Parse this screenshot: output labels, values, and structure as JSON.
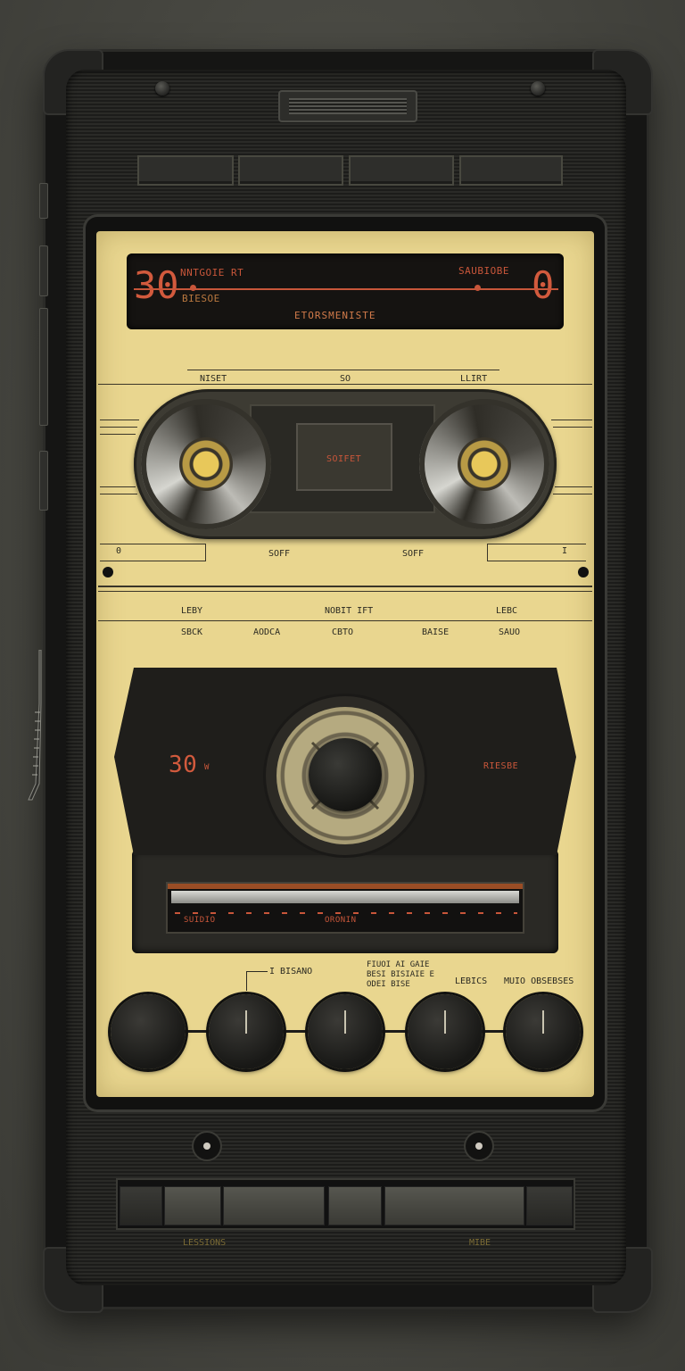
{
  "display": {
    "counter_left": "30",
    "left_line1": "NNTGOIE RT",
    "left_line2": "BIESOE",
    "right_line1": "SAUBIOBE",
    "counter_right": "0",
    "center_label": "ETORSMENISTE"
  },
  "tape": {
    "top_left": "NISET",
    "top_center": "SO",
    "top_right": "LLIRT",
    "cassette_label": "SOIFET",
    "left_counter": "0",
    "right_counter": "I",
    "side_a": "SOFF",
    "side_b": "SOFF"
  },
  "controls_labels": {
    "row1": [
      "LEBY",
      "NOBIT IFT",
      "LEBC"
    ],
    "row2": [
      "SBCK",
      "AODCA",
      "CBTO",
      "BAISE",
      "SAUO"
    ]
  },
  "deck": {
    "left_readout": "30",
    "left_unit": "W",
    "right_label": "RIESBE",
    "meter_left": "SUIDIO",
    "meter_center": "ORONIN"
  },
  "knobs": {
    "labels": [
      "I BISANO",
      "FIUOI AI GAIE\nBESI BISIAIE E\nODEI BISE",
      "LEBICS",
      "MUIO OBSEBSES"
    ],
    "count": 5
  },
  "bottom": {
    "left_label": "LESSIONS",
    "right_label": "MIBE"
  },
  "colors": {
    "panel": "#e9d68f",
    "display_text": "#c8563a",
    "body": "#151514"
  }
}
